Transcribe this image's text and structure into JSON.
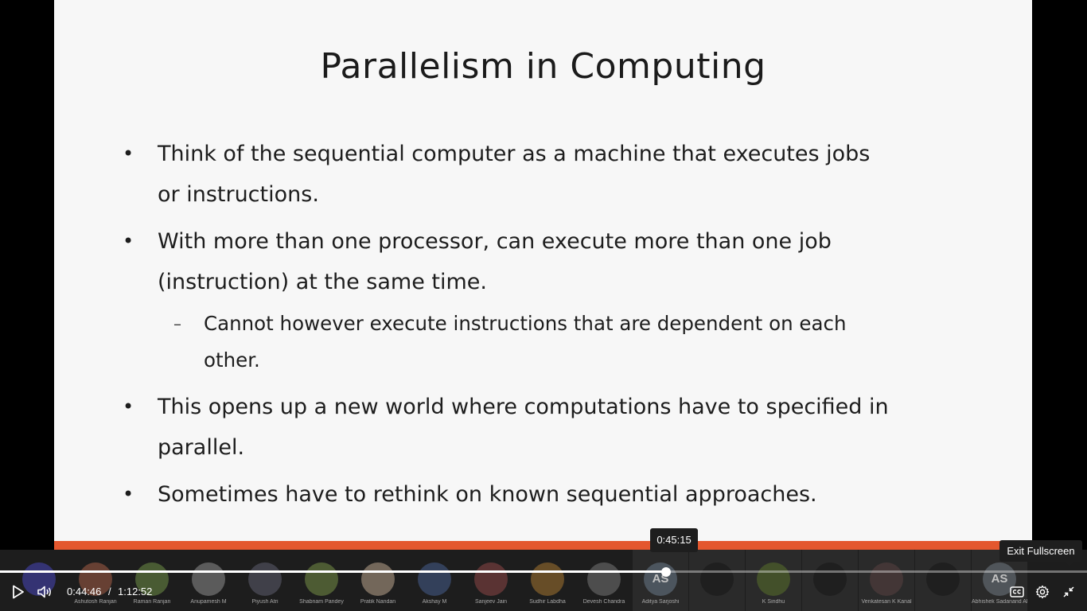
{
  "slide": {
    "title": "Parallelism in Computing",
    "bullet1": "Think of the sequential computer as a machine that executes jobs or instructions.",
    "bullet2": "With more than one processor, can execute more than one job (instruction) at the same time.",
    "sub1": "Cannot however execute instructions that are dependent on each other.",
    "bullet3": "This opens up a new world where computations have to specified in parallel.",
    "bullet4": "Sometimes have to rethink on known sequential approaches.",
    "bullet_glyph": "•",
    "sub_glyph": "–"
  },
  "player": {
    "current_time": "0:44:46",
    "separator": "/",
    "duration": "1:12:52",
    "hover_time": "0:45:15",
    "progress_fraction": 0.613,
    "fullscreen_tooltip": "Exit Fullscreen",
    "icons": {
      "play": "play-icon",
      "volume": "volume-icon",
      "captions": "captions-icon",
      "settings": "gear-icon",
      "exit_fullscreen": "exit-fullscreen-icon"
    }
  },
  "participants": [
    {
      "initials": "",
      "name": "",
      "color": "#3b3a8a"
    },
    {
      "initials": "",
      "name": "Ashutosh Ranjan",
      "color": "#7a4a3a"
    },
    {
      "initials": "",
      "name": "Raman Ranjan",
      "color": "#556b3a"
    },
    {
      "initials": "",
      "name": "Anupamesh M",
      "color": "#6b6b6b"
    },
    {
      "initials": "",
      "name": "Piyush Atri",
      "color": "#4a4a55"
    },
    {
      "initials": "",
      "name": "Shabnam Pandey",
      "color": "#5a6b3a"
    },
    {
      "initials": "",
      "name": "Pratik Nandan",
      "color": "#8a7a6a"
    },
    {
      "initials": "",
      "name": "Akshay M",
      "color": "#3a4a6a"
    },
    {
      "initials": "",
      "name": "Sanjeev Jain",
      "color": "#6a3a3a"
    },
    {
      "initials": "",
      "name": "Sudhir Labdha",
      "color": "#7a5a2a"
    },
    {
      "initials": "",
      "name": "Devesh Chandra",
      "color": "#5a5a5a"
    },
    {
      "initials": "AS",
      "name": "Aditya Sarjoshi",
      "color": "#55606b"
    },
    {
      "initials": "",
      "name": "",
      "color": "#1d1d1d"
    },
    {
      "initials": "",
      "name": "K Sindhu",
      "color": "#4a5a2a"
    },
    {
      "initials": "",
      "name": "",
      "color": "#1d1d1d"
    },
    {
      "initials": "",
      "name": "Venkatesan K Kanal",
      "color": "#4a3a3a"
    },
    {
      "initials": "",
      "name": "",
      "color": "#1d1d1d"
    },
    {
      "initials": "AS",
      "name": "Abhishek Sadanand Ahire",
      "color": "#5a6066"
    }
  ]
}
